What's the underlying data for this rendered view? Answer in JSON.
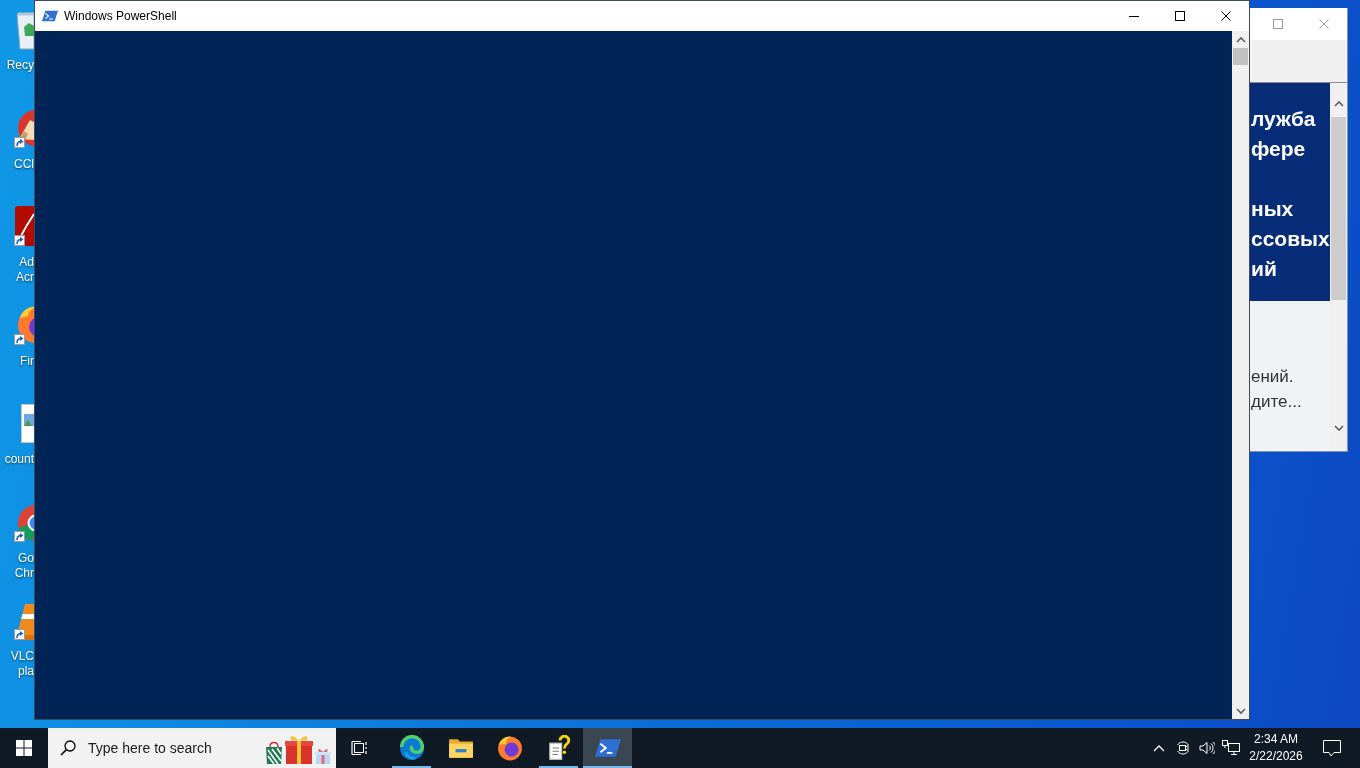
{
  "desktop": {
    "icons": [
      {
        "kind": "recycle-bin",
        "shortcut": false,
        "label_lines": [
          "Recy"
        ]
      },
      {
        "kind": "cleaner",
        "shortcut": true,
        "label_lines": [
          "CCl"
        ]
      },
      {
        "kind": "pdf-reader",
        "shortcut": true,
        "label_lines": [
          "Ad",
          "Acr"
        ]
      },
      {
        "kind": "firefox",
        "shortcut": true,
        "label_lines": [
          "Fir"
        ]
      },
      {
        "kind": "image-file",
        "shortcut": false,
        "label_lines": [
          "count"
        ]
      },
      {
        "kind": "chrome",
        "shortcut": true,
        "label_lines": [
          "Go",
          "Chr"
        ]
      },
      {
        "kind": "vlc",
        "shortcut": true,
        "label_lines": [
          "VLC",
          "pla"
        ]
      }
    ]
  },
  "powershell_window": {
    "title": "Windows PowerShell"
  },
  "browser_window": {
    "heading_blocks": [
      [
        "лужба",
        "фере"
      ],
      [
        "ных",
        "ссовых",
        "ий"
      ]
    ],
    "text_lines": [
      "ений.",
      "дите..."
    ]
  },
  "taskbar": {
    "search": {
      "placeholder": "Type here to search"
    },
    "apps": [
      {
        "kind": "edge",
        "running": true,
        "selected": false
      },
      {
        "kind": "file-explorer",
        "running": false,
        "selected": false
      },
      {
        "kind": "firefox",
        "running": false,
        "selected": false
      },
      {
        "kind": "help-document",
        "running": true,
        "selected": false
      },
      {
        "kind": "powershell",
        "running": true,
        "selected": true
      }
    ],
    "clock": {
      "time": "2:34 AM",
      "date": "2/22/2026"
    }
  }
}
